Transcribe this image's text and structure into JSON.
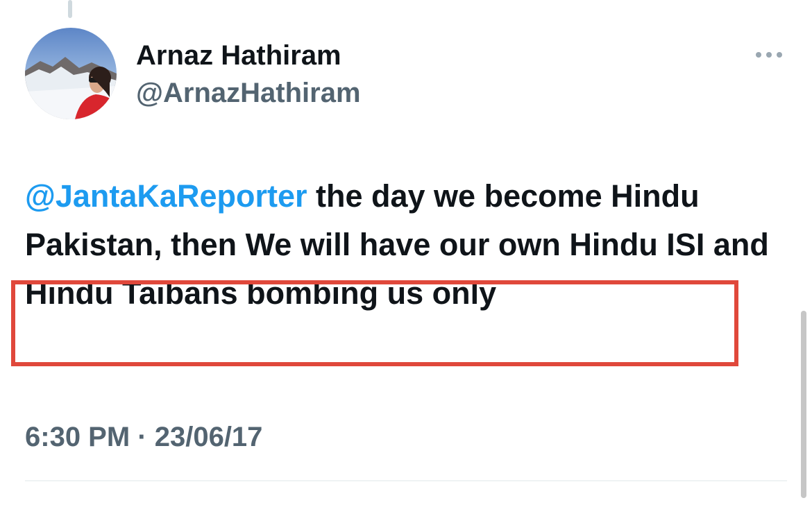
{
  "author": {
    "display_name": "Arnaz Hathiram",
    "handle": "@ArnazHathiram",
    "avatar_icon": "profile-photo-avatar"
  },
  "tweet": {
    "mention": "@JantaKaReporter",
    "text_before_highlight": " the day we become Hindu Pakistan, then We will have our own ",
    "text_highlighted": "Hindu ISI and Hindu Taibans bombing us only",
    "timestamp": "6:30 PM · 23/06/17"
  },
  "icons": {
    "more": "more-options-icon"
  },
  "colors": {
    "mention_blue": "#1d9bf0",
    "secondary_text": "#536471",
    "primary_text": "#0f1419",
    "annotation_red": "#e0483b"
  }
}
